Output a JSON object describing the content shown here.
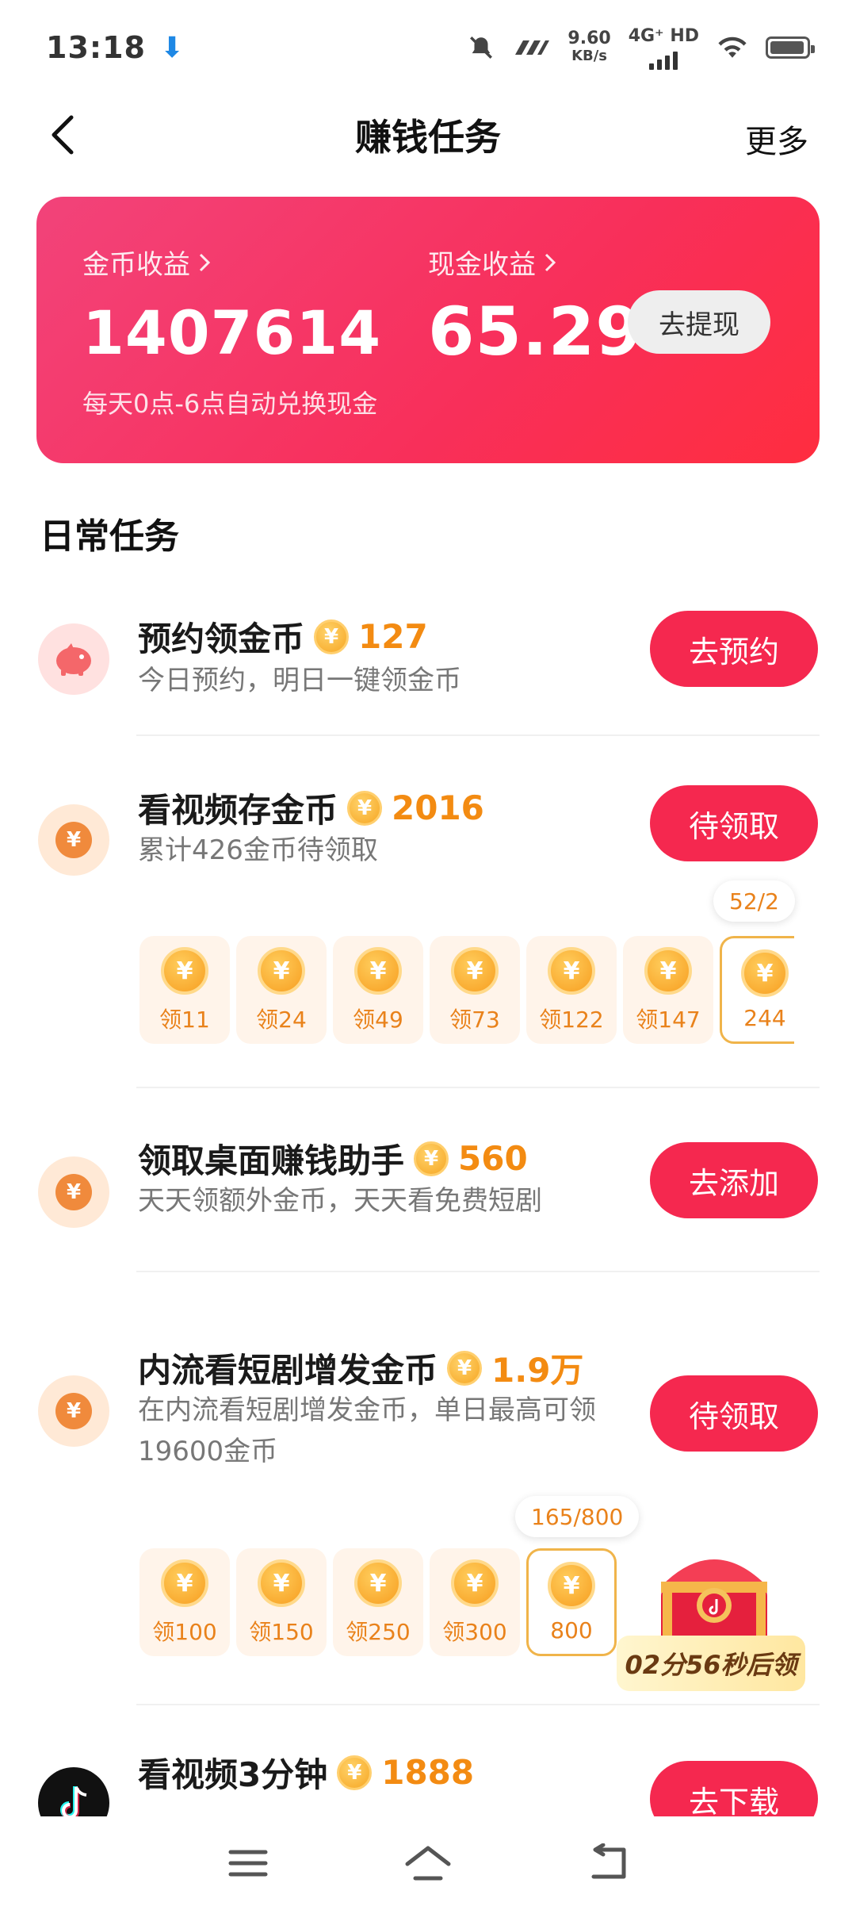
{
  "status_bar": {
    "time": "13:18",
    "speed_value": "9.60",
    "speed_unit": "KB/s",
    "network": "4G⁺ HD"
  },
  "header": {
    "title": "赚钱任务",
    "more_label": "更多"
  },
  "earnings": {
    "coin_label": "金币收益",
    "coin_value": "1407614",
    "cash_label": "现金收益",
    "cash_value": "65.29",
    "withdraw_label": "去提现",
    "hint": "每天0点-6点自动兑换现金"
  },
  "section_title": "日常任务",
  "tasks": [
    {
      "name": "预约领金币",
      "reward": "127",
      "desc": "今日预约，明日一键领金币",
      "button": "去预约",
      "icon": "piggy-bank-icon"
    },
    {
      "name": "看视频存金币",
      "reward": "2016",
      "desc": "累计426金币待领取",
      "button": "待领取",
      "icon": "yuan-coin-icon",
      "progress_label": "52/2",
      "cells": [
        "领11",
        "领24",
        "领49",
        "领73",
        "领122",
        "领147",
        "244"
      ]
    },
    {
      "name": "领取桌面赚钱助手",
      "reward": "560",
      "desc": "天天领额外金币，天天看免费短剧",
      "button": "去添加",
      "icon": "yuan-coin-icon"
    },
    {
      "name": "内流看短剧增发金币",
      "reward": "1.9万",
      "desc": "在内流看短剧增发金币，单日最高可领19600金币",
      "button": "待领取",
      "icon": "yuan-coin-icon",
      "progress_label": "165/800",
      "cells": [
        "领100",
        "领150",
        "领250",
        "领300",
        "800"
      ],
      "timer_label": "02分56秒后领"
    },
    {
      "name": "看视频3分钟",
      "reward": "1888",
      "button": "去下载",
      "icon": "tiktok-icon"
    }
  ],
  "coin_glyph": "¥",
  "colors": {
    "accent": "#f5284f",
    "card_start": "#f2437a",
    "card_end": "#ff2d3f",
    "reward": "#f38b12"
  }
}
